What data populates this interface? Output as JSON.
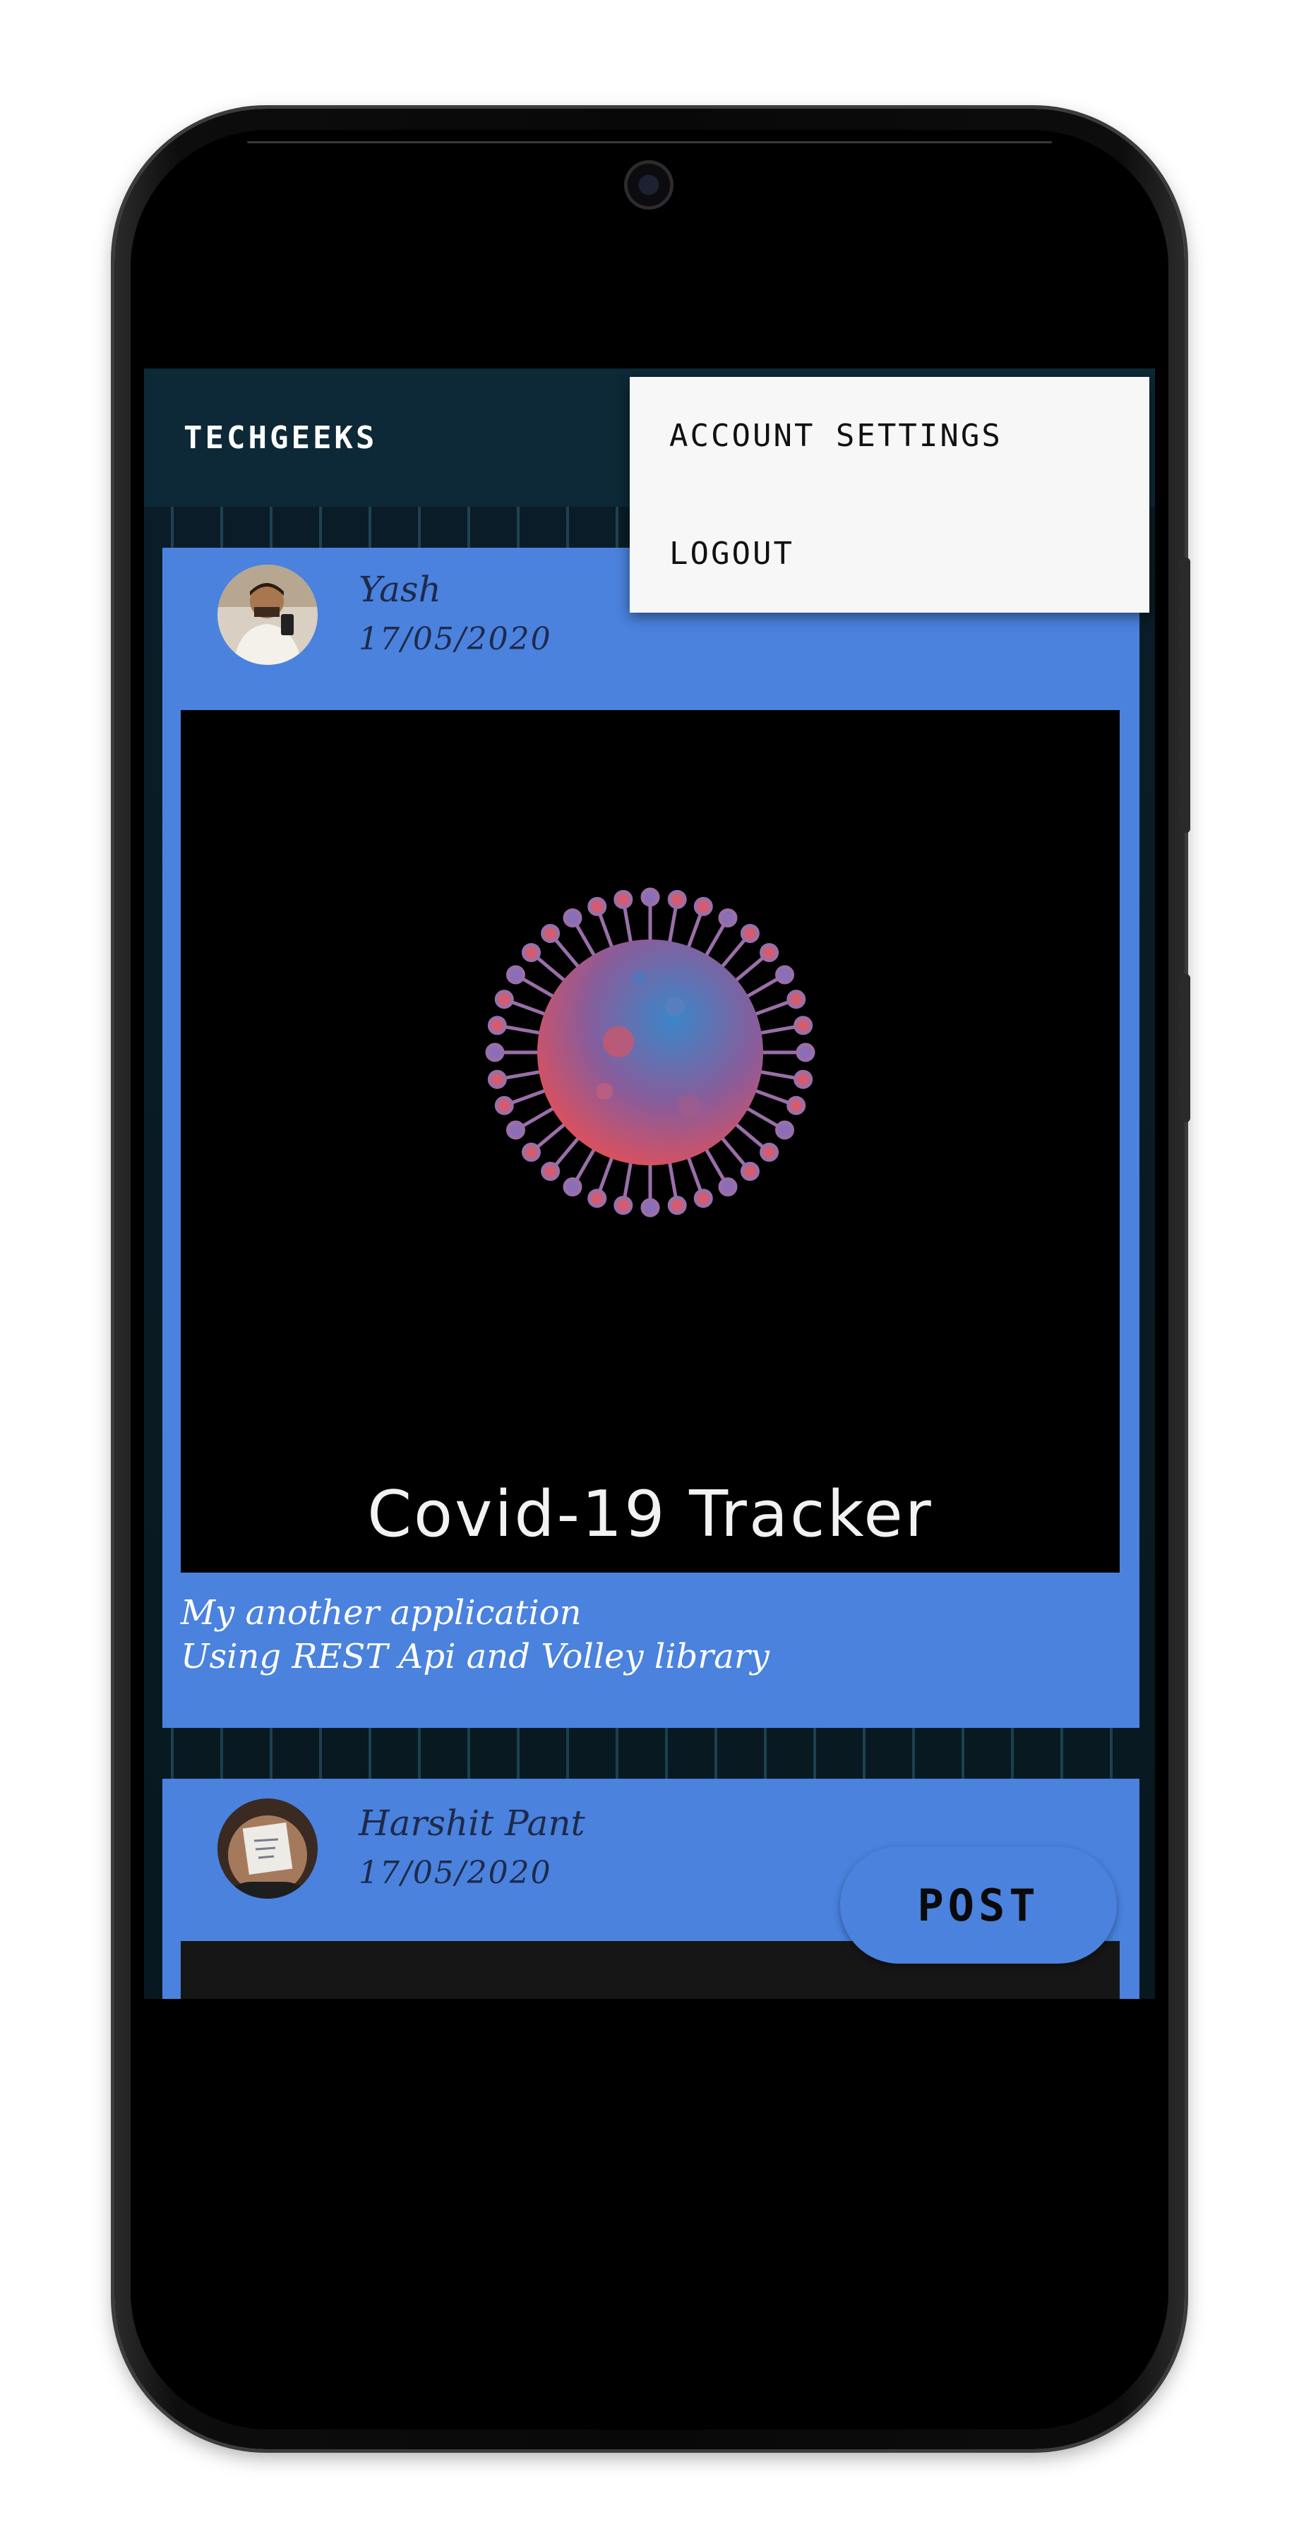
{
  "app_bar": {
    "title": "TECHGEEKS"
  },
  "overflow_menu": {
    "items": [
      {
        "label": "ACCOUNT SETTINGS"
      },
      {
        "label": "LOGOUT"
      }
    ]
  },
  "posts": [
    {
      "author": "Yash",
      "date": "17/05/2020",
      "image_caption": "Covid-19 Tracker",
      "text_lines": [
        "My another application",
        "Using REST Api and Volley library"
      ]
    },
    {
      "author": "Harshit Pant",
      "date": "17/05/2020"
    }
  ],
  "fab": {
    "label": "POST"
  },
  "bottom_nav": {
    "items": [
      {
        "icon": "home-icon"
      },
      {
        "icon": "bell-icon"
      },
      {
        "icon": "account-circle-icon"
      }
    ]
  },
  "colors": {
    "card": "#4a82de",
    "app_bar": "#0d2836",
    "menu_bg": "#f7f7f7",
    "nav_bg": "#000000"
  }
}
